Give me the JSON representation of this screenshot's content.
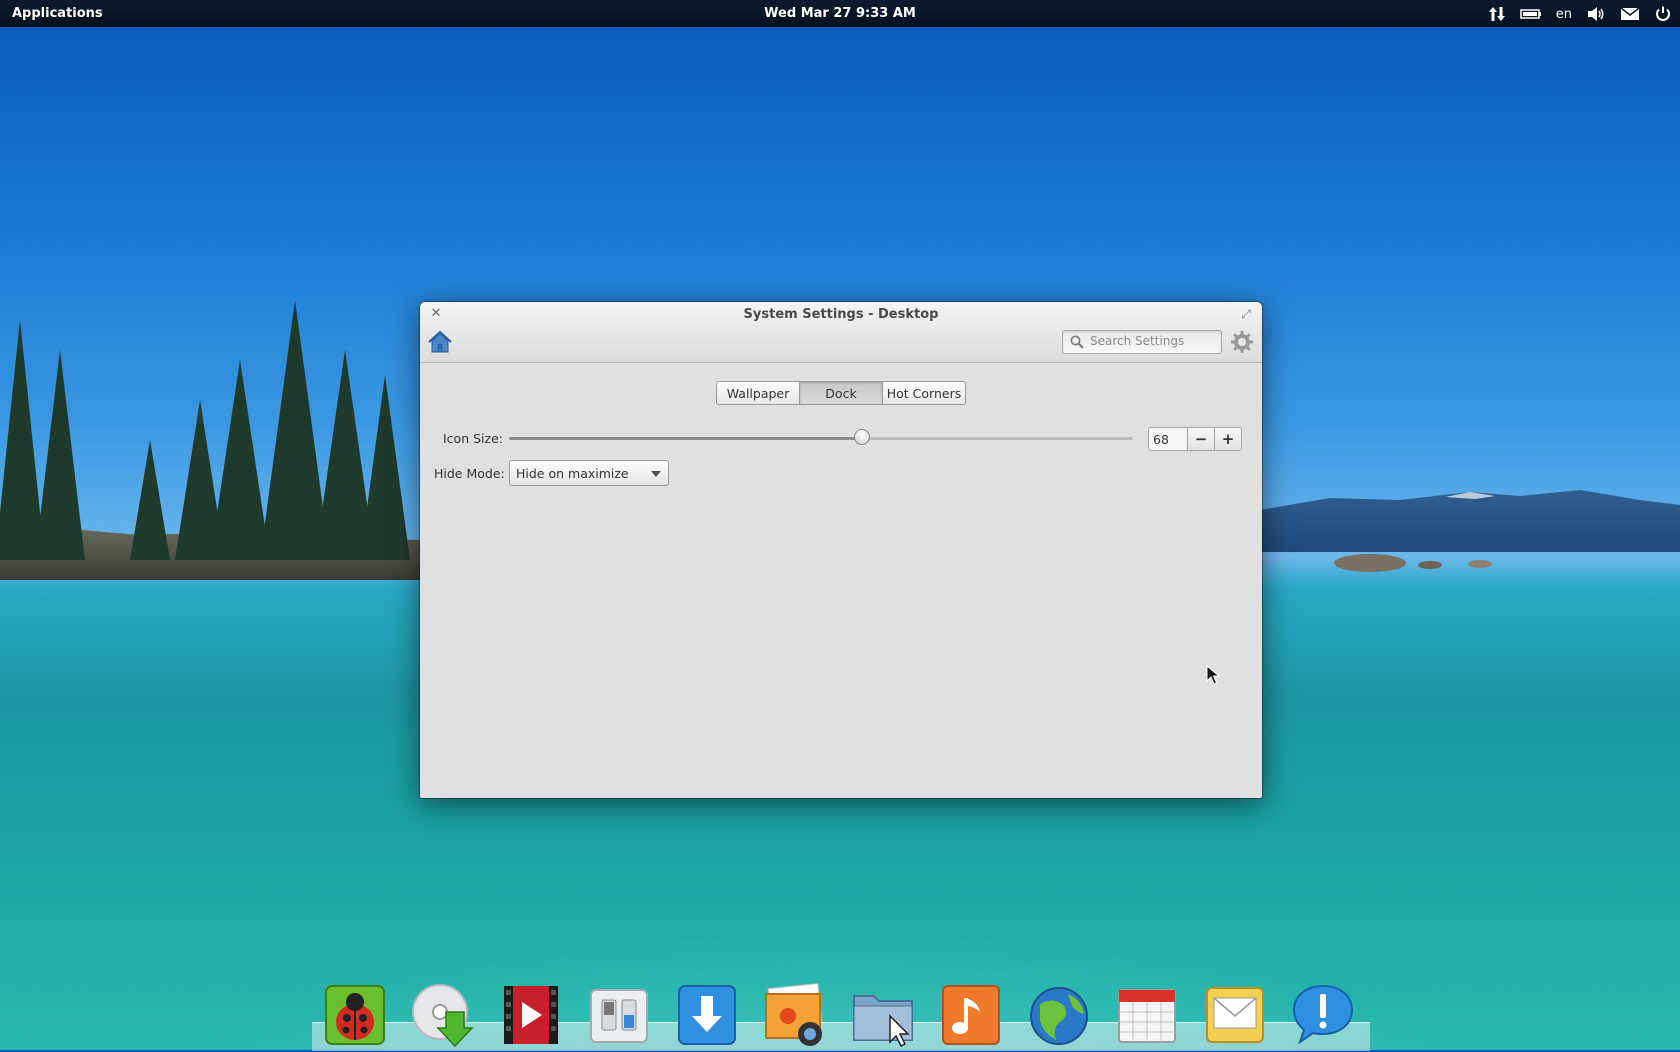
{
  "panel": {
    "applications": "Applications",
    "clock": "Wed Mar 27  9:33 AM",
    "keyboard_layout": "en",
    "tray_icons": [
      "network-transfer-icon",
      "battery-icon",
      "keyboard-layout",
      "volume-icon",
      "mail-icon",
      "power-icon"
    ]
  },
  "window": {
    "title": "System Settings - Desktop",
    "search_placeholder": "Search Settings",
    "tabs": [
      {
        "label": "Wallpaper",
        "active": false
      },
      {
        "label": "Dock",
        "active": true
      },
      {
        "label": "Hot Corners",
        "active": false
      }
    ],
    "icon_size": {
      "label": "Icon Size:",
      "value": "68",
      "slider_fraction": 0.565,
      "minus": "−",
      "plus": "+"
    },
    "hide_mode": {
      "label": "Hide Mode:",
      "selected": "Hide on maximize"
    }
  },
  "dock": {
    "items": [
      {
        "icon": "ladybug-app-icon"
      },
      {
        "icon": "disc-install-icon"
      },
      {
        "icon": "video-player-icon"
      },
      {
        "icon": "system-settings-icon"
      },
      {
        "icon": "download-icon"
      },
      {
        "icon": "photos-icon"
      },
      {
        "icon": "file-manager-icon"
      },
      {
        "icon": "music-icon"
      },
      {
        "icon": "web-browser-icon"
      },
      {
        "icon": "calendar-icon"
      },
      {
        "icon": "mail-client-icon"
      },
      {
        "icon": "notification-app-icon"
      }
    ]
  },
  "colors": {
    "panel_bg": "#081626",
    "window_bg": "#e0e0e0",
    "sky": "#1a79d4",
    "water": "#18a3a2"
  }
}
